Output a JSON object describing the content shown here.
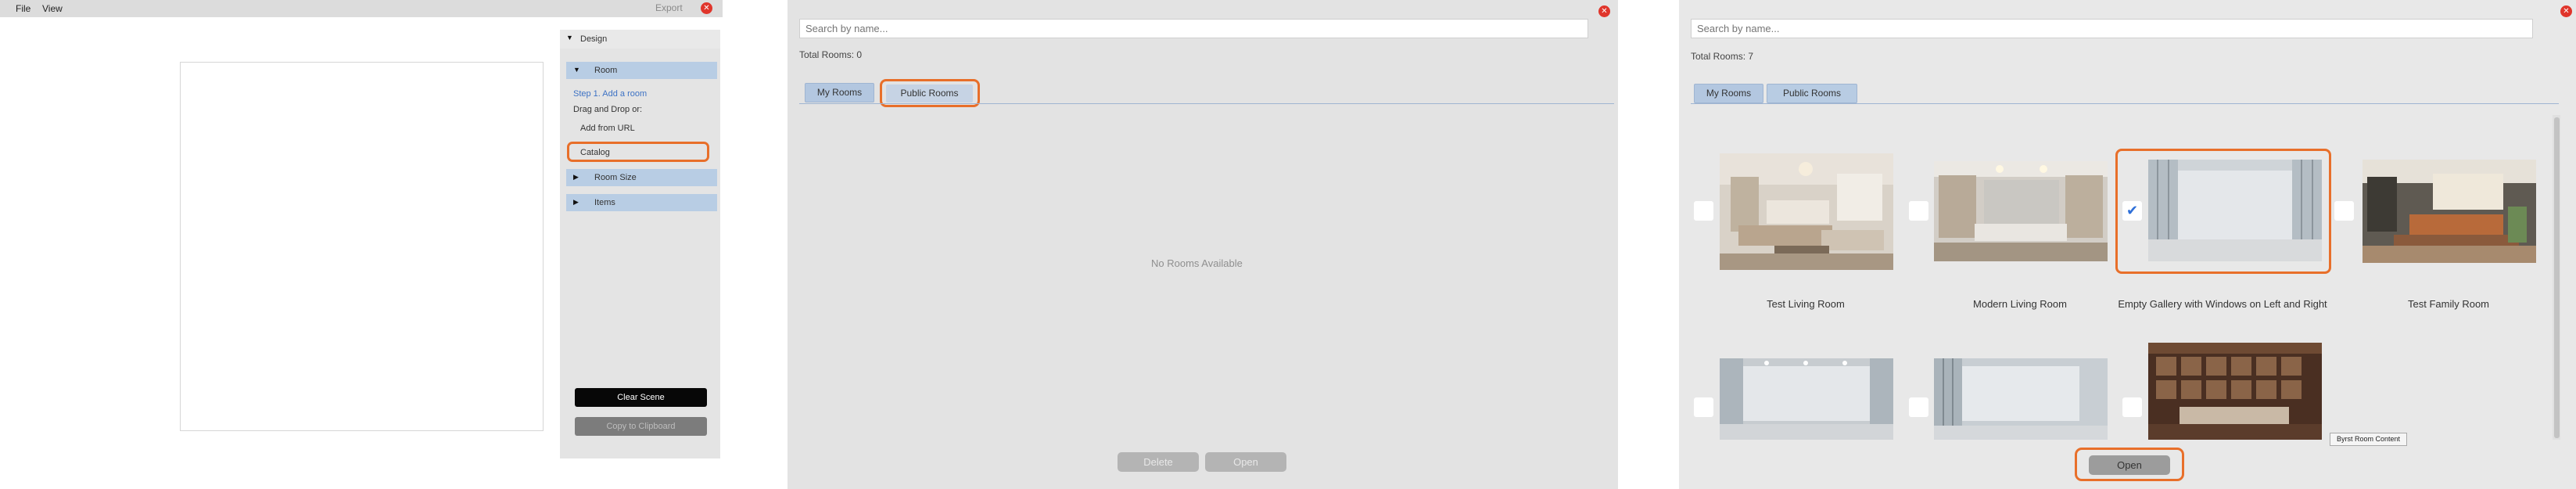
{
  "editor": {
    "menu": {
      "file": "File",
      "view": "View"
    },
    "export_label": "Export",
    "close_glyph": "✕",
    "design_section": "Design",
    "room_section": "Room",
    "step_text": "Step 1. Add a room",
    "drag_drop_text": "Drag and Drop or:",
    "add_from_url": "Add from URL",
    "catalog": "Catalog",
    "room_size_section": "Room Size",
    "items_section": "Items",
    "clear_scene": "Clear Scene",
    "copy_clipboard": "Copy to Clipboard",
    "triangle_down": "▼",
    "triangle_right": "▶"
  },
  "dialog_empty": {
    "search_placeholder": "Search by name...",
    "total_rooms": "Total Rooms: 0",
    "tabs": [
      "My Rooms",
      "Public Rooms"
    ],
    "empty_text": "No Rooms Available",
    "delete_label": "Delete",
    "open_label": "Open",
    "close_glyph": "✕"
  },
  "dialog_public": {
    "search_placeholder": "Search by name...",
    "total_rooms": "Total Rooms: 7",
    "tabs": [
      "My Rooms",
      "Public Rooms"
    ],
    "close_glyph": "✕",
    "check_glyph": "✔",
    "rooms": [
      {
        "name": "Test Living Room",
        "checked": false
      },
      {
        "name": "Modern Living Room",
        "checked": false
      },
      {
        "name": "Empty Gallery with Windows on Left and Right",
        "checked": true
      },
      {
        "name": "Test Family Room",
        "checked": false
      },
      {
        "name": "",
        "checked": false
      },
      {
        "name": "",
        "checked": false
      },
      {
        "name": "",
        "checked": false
      }
    ],
    "open_label": "Open",
    "tooltip": "Byrst Room Content"
  },
  "colors": {
    "highlight": "#e86f2a",
    "tab_blue": "#b3c7e0",
    "close_red": "#e0352b",
    "link_blue": "#3d72c4",
    "check_blue": "#2e6fd8"
  }
}
